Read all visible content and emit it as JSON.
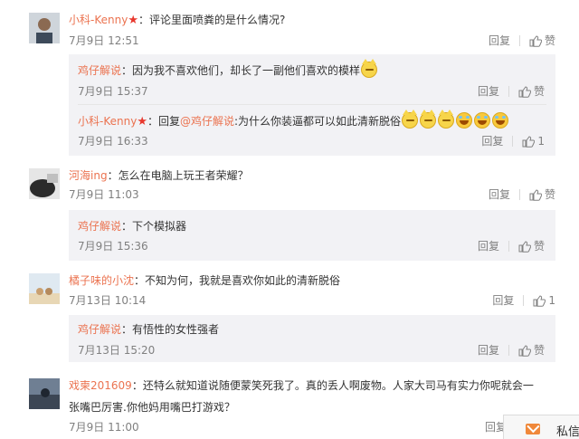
{
  "comments": [
    {
      "user": "小科-Kenny",
      "verified_icon": "star-icon",
      "text": "：评论里面喷粪的是什么情况?",
      "time": "7月9日 12:51",
      "reply_label": "回复",
      "like_label": "赞",
      "replies": [
        {
          "user": "鸡仔解说",
          "text": "：因为我不喜欢他们，却长了一副他们喜欢的模样",
          "time": "7月9日 15:37",
          "reply_label": "回复",
          "like_label": "赞"
        },
        {
          "user": "小科-Kenny",
          "verified_icon": "star-icon",
          "text_prefix": "：回复",
          "mention": "@鸡仔解说",
          "text": ":为什么你装逼都可以如此清新脱俗",
          "time": "7月9日 16:33",
          "reply_label": "回复",
          "like_label": "1"
        }
      ]
    },
    {
      "user": "河海ing",
      "text": "：怎么在电脑上玩王者荣耀？",
      "time": "7月9日 11:03",
      "reply_label": "回复",
      "like_label": "赞",
      "replies": [
        {
          "user": "鸡仔解说",
          "text": "：下个模拟器",
          "time": "7月9日 15:36",
          "reply_label": "回复",
          "like_label": "赞"
        }
      ]
    },
    {
      "user": "橘子味的小沈",
      "text": "：不知为何，我就是喜欢你如此的清新脱俗",
      "time": "7月13日 10:14",
      "reply_label": "回复",
      "like_label": "1",
      "replies": [
        {
          "user": "鸡仔解说",
          "text": "：有悟性的女性强者",
          "time": "7月13日 15:20",
          "reply_label": "回复",
          "like_label": "赞"
        }
      ]
    },
    {
      "user": "戏柬201609",
      "text": "：还特么就知道说随便蒙笑死我了。真的丢人啊废物。人家大司马有实力你呢就会一",
      "text_line2": "张嘴巴厉害.你他妈用嘴巴打游戏？",
      "time": "7月9日 11:00",
      "reply_label": "回复",
      "like_label": ""
    }
  ],
  "private_message": {
    "label": "私信",
    "icon": "mail-icon"
  },
  "colors": {
    "username": "#eb7350",
    "meta": "#808080",
    "reply_bg": "#f2f2f5"
  }
}
